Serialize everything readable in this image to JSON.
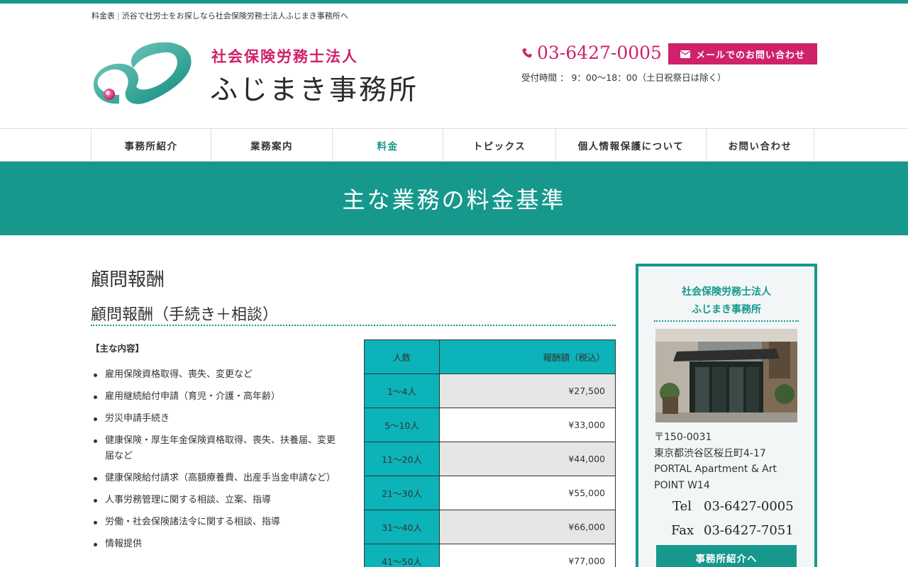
{
  "breadcrumb": {
    "current": "料金表",
    "site": "渋谷で社労士をお探しなら社会保険労務士法人ふじまき事務所へ"
  },
  "logo": {
    "subtitle": "社会保険労務士法人",
    "name": "ふじまき事務所",
    "colors": {
      "teal": "#16988d",
      "pink": "#d0216b"
    }
  },
  "contact": {
    "phone": "03-6427-0005",
    "hours": "受付時間 ： 9：00〜18：00（土日祝祭日は除く）",
    "mail_button": "メールでのお問い合わせ",
    "phone_icon": "phone-icon",
    "mail_icon": "envelope-icon"
  },
  "nav": {
    "items": [
      {
        "label": "事務所紹介"
      },
      {
        "label": "業務案内"
      },
      {
        "label": "料金"
      },
      {
        "label": "トピックス"
      },
      {
        "label": "個人情報保護について"
      },
      {
        "label": "お問い合わせ"
      }
    ],
    "active": "料金"
  },
  "hero": {
    "title": "主な業務の料金基準"
  },
  "main": {
    "heading": "顧問報酬",
    "subheading": "顧問報酬（手続き＋相談）",
    "content_label": "【主な内容】",
    "bullets": [
      "雇用保険資格取得、喪失、変更など",
      "雇用継続給付申請（育児・介護・高年齢）",
      "労災申請手続き",
      "健康保険・厚生年金保険資格取得、喪失、扶養届、変更届など",
      "健康保険給付請求（高額療養費、出産手当金申請など）",
      "人事労務管理に関する相談、立案、指導",
      "労働・社会保険諸法令に関する相談、指導",
      "情報提供"
    ],
    "table": {
      "headers": [
        "人数",
        "報酬額（税込）"
      ],
      "rows": [
        [
          "1〜4人",
          "¥27,500"
        ],
        [
          "5〜10人",
          "¥33,000"
        ],
        [
          "11〜20人",
          "¥44,000"
        ],
        [
          "21〜30人",
          "¥55,000"
        ],
        [
          "31〜40人",
          "¥66,000"
        ],
        [
          "41〜50人",
          "¥77,000"
        ]
      ]
    }
  },
  "sidebar": {
    "title_line1": "社会保険労務士法人",
    "title_line2": "ふじまき事務所",
    "postal": "〒150-0031",
    "address1": "東京都渋谷区桜丘町4-17",
    "address2": "PORTAL Apartment & Art",
    "address3": "POINT W14",
    "tel_label": "Tel",
    "tel": "03-6427-0005",
    "fax_label": "Fax",
    "fax": "03-6427-7051",
    "button": "事務所紹介へ"
  }
}
